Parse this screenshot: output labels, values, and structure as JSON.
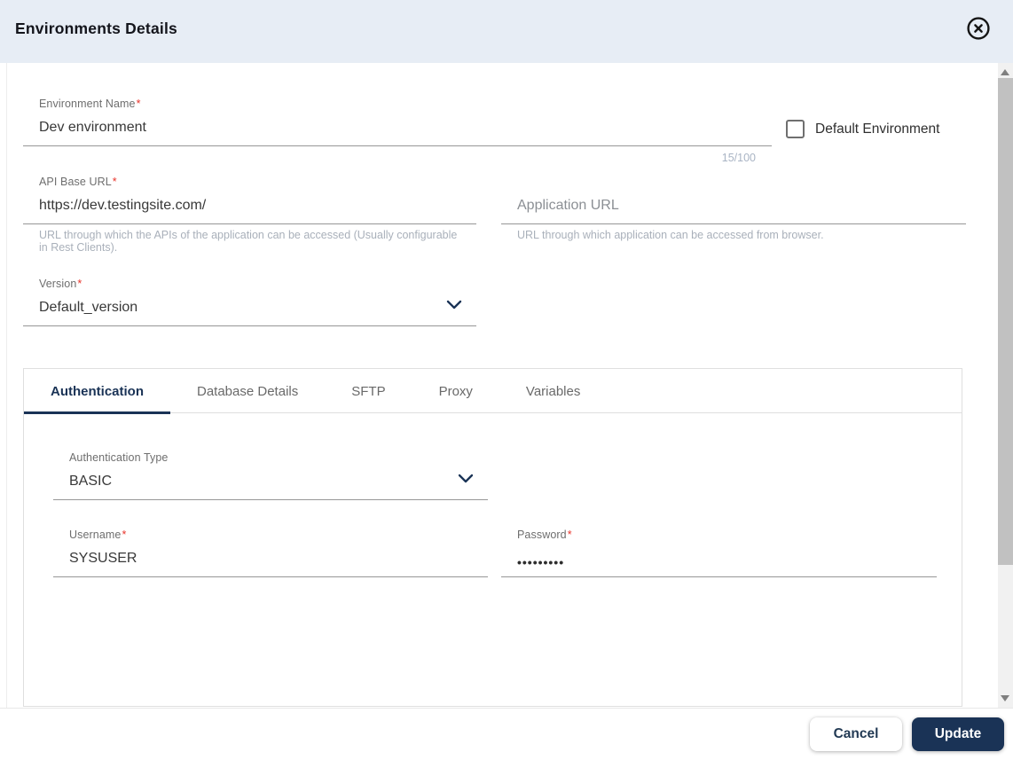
{
  "colors": {
    "primary": "#1a3356",
    "header_bg": "#e7edf5",
    "asterisk": "#e8332a"
  },
  "ui": {
    "required_marker": "*"
  },
  "dialog": {
    "title": "Environments Details",
    "close_icon": "circle-x-icon"
  },
  "form": {
    "environment_name": {
      "label": "Environment Name",
      "required": true,
      "value": "Dev environment",
      "counter": "15/100"
    },
    "default_environment": {
      "label": "Default Environment",
      "checked": false
    },
    "api_base_url": {
      "label": "API Base URL",
      "required": true,
      "value": "https://dev.testingsite.com/",
      "helper": "URL through which the APIs of the application can be accessed (Usually configurable in Rest Clients)."
    },
    "application_url": {
      "label": "Application URL",
      "value": "",
      "placeholder": "Application URL",
      "helper": "URL through which application can be accessed from browser."
    },
    "version": {
      "label": "Version",
      "required": true,
      "value": "Default_version"
    }
  },
  "tabs": [
    {
      "label": "Authentication",
      "active": true
    },
    {
      "label": "Database Details",
      "active": false
    },
    {
      "label": "SFTP",
      "active": false
    },
    {
      "label": "Proxy",
      "active": false
    },
    {
      "label": "Variables",
      "active": false
    }
  ],
  "authentication": {
    "type": {
      "label": "Authentication Type",
      "value": "BASIC"
    },
    "username": {
      "label": "Username",
      "required": true,
      "value": "SYSUSER"
    },
    "password": {
      "label": "Password",
      "required": true,
      "masked_value": "•••••••••"
    }
  },
  "footer": {
    "cancel_label": "Cancel",
    "update_label": "Update"
  }
}
